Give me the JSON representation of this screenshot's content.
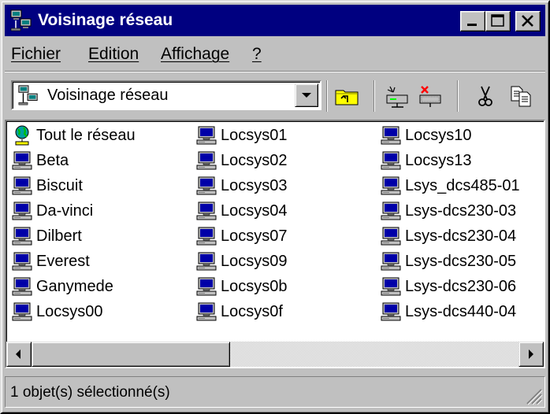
{
  "window": {
    "title": "Voisinage réseau"
  },
  "menu": [
    {
      "label": "Fichier"
    },
    {
      "label": "Edition"
    },
    {
      "label": "Affichage"
    },
    {
      "label": "?"
    }
  ],
  "toolbar": {
    "address_value": "Voisinage réseau",
    "address_icon": "network-neighborhood-icon",
    "buttons": [
      "up-one-level-icon",
      "map-network-drive-icon",
      "disconnect-network-drive-icon",
      "cut-icon",
      "copy-icon"
    ]
  },
  "items": [
    {
      "label": "Tout le réseau",
      "icon": "globe-network-icon"
    },
    {
      "label": "Beta",
      "icon": "computer-icon"
    },
    {
      "label": "Biscuit",
      "icon": "computer-icon"
    },
    {
      "label": "Da-vinci",
      "icon": "computer-icon"
    },
    {
      "label": "Dilbert",
      "icon": "computer-icon"
    },
    {
      "label": "Everest",
      "icon": "computer-icon"
    },
    {
      "label": "Ganymede",
      "icon": "computer-icon"
    },
    {
      "label": "Locsys00",
      "icon": "computer-icon"
    },
    {
      "label": "Locsys01",
      "icon": "computer-icon"
    },
    {
      "label": "Locsys02",
      "icon": "computer-icon"
    },
    {
      "label": "Locsys03",
      "icon": "computer-icon"
    },
    {
      "label": "Locsys04",
      "icon": "computer-icon"
    },
    {
      "label": "Locsys07",
      "icon": "computer-icon"
    },
    {
      "label": "Locsys09",
      "icon": "computer-icon"
    },
    {
      "label": "Locsys0b",
      "icon": "computer-icon"
    },
    {
      "label": "Locsys0f",
      "icon": "computer-icon"
    },
    {
      "label": "Locsys10",
      "icon": "computer-icon"
    },
    {
      "label": "Locsys13",
      "icon": "computer-icon"
    },
    {
      "label": "Lsys_dcs485-01",
      "icon": "computer-icon"
    },
    {
      "label": "Lsys-dcs230-03",
      "icon": "computer-icon"
    },
    {
      "label": "Lsys-dcs230-04",
      "icon": "computer-icon"
    },
    {
      "label": "Lsys-dcs230-05",
      "icon": "computer-icon"
    },
    {
      "label": "Lsys-dcs230-06",
      "icon": "computer-icon"
    },
    {
      "label": "Lsys-dcs440-04",
      "icon": "computer-icon"
    }
  ],
  "status": {
    "text": "1 objet(s) sélectionné(s)"
  },
  "colors": {
    "titlebar": "#000080",
    "face": "#c0c0c0",
    "list_bg": "#ffffff"
  }
}
